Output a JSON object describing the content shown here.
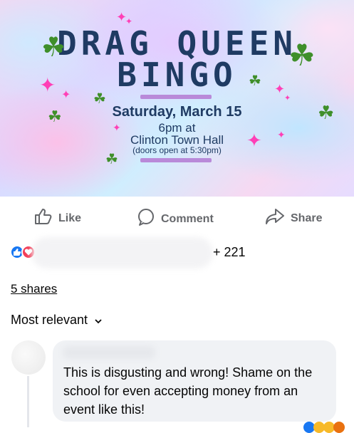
{
  "banner": {
    "title_line1": "DRAG QUEEN",
    "title_line2": "BINGO",
    "date": "Saturday, March 15",
    "time": "6pm at",
    "venue": "Clinton Town Hall",
    "doors": "(doors open at 5:30pm)"
  },
  "actions": {
    "like": "Like",
    "comment": "Comment",
    "share": "Share"
  },
  "reactions": {
    "count": "+ 221",
    "icons": [
      "like-icon",
      "heart-icon"
    ]
  },
  "shares": "5 shares",
  "sort": {
    "label": "Most relevant"
  },
  "comment": {
    "text": "This is disgusting and wrong! Shame on the school for even accepting money from an event like this!"
  },
  "colors": {
    "title": "#1f3b63",
    "accent_bar": "#b98ad9",
    "clover": "#3f8f2a",
    "sparkle": "#ff3fb6",
    "like_blue": "#1877f2",
    "heart_red": "#f33e58"
  }
}
